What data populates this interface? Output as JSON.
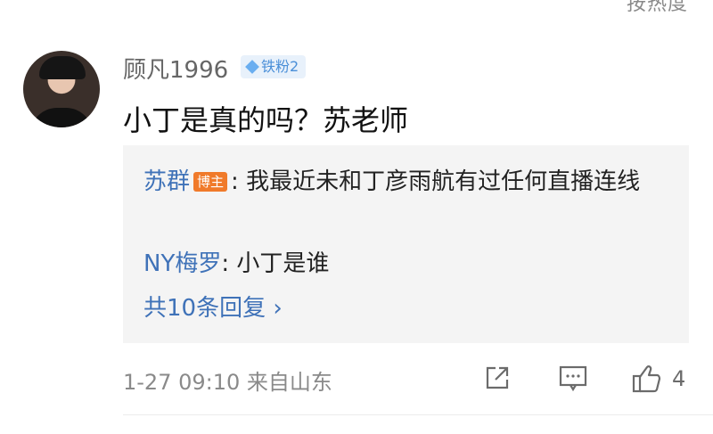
{
  "sort": {
    "label": "按热度"
  },
  "comment": {
    "username": "顾凡1996",
    "badge": "铁粉2",
    "text": "小丁是真的吗？苏老师",
    "replies": [
      {
        "user": "苏群",
        "badge": "博主",
        "text": "我最近未和丁彦雨航有过任何直播连线"
      },
      {
        "user": "NY梅罗",
        "text": "小丁是谁"
      }
    ],
    "more_replies": "共10条回复 ›",
    "time": "1-27 09:10",
    "location": "来自山东",
    "like_count": "4"
  },
  "icons": {
    "share": "share-icon",
    "reply": "comment-icon",
    "like": "thumbs-up-icon"
  },
  "colors": {
    "link": "#3f72b8",
    "host_badge": "#f07a2a",
    "fan_badge": "#4a8fd8"
  }
}
